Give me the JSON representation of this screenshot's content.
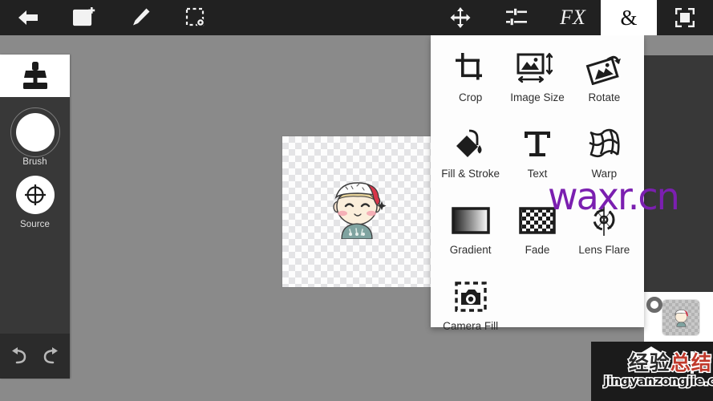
{
  "app": {
    "background_color": "#8a8a8a",
    "toolbar_color": "#212121",
    "panel_color": "#383838",
    "accent_active": "#ffffff"
  },
  "toolbar": {
    "items": [
      {
        "id": "back",
        "icon": "back-arrow-icon",
        "label": "Back",
        "active": false
      },
      {
        "id": "add-image",
        "icon": "add-image-icon",
        "label": "Add Image",
        "active": false
      },
      {
        "id": "brush",
        "icon": "pencil-icon",
        "label": "Brush",
        "active": false
      },
      {
        "id": "selection",
        "icon": "selection-settings-icon",
        "label": "Selection",
        "active": false
      },
      {
        "id": "transform",
        "icon": "move-arrows-icon",
        "label": "Transform",
        "active": false
      },
      {
        "id": "adjustments",
        "icon": "sliders-icon",
        "label": "Adjustments",
        "active": false
      },
      {
        "id": "effects",
        "icon": "fx-icon",
        "label": "FX",
        "active": false
      },
      {
        "id": "tools",
        "icon": "ampersand-icon",
        "label": "&",
        "active": true
      },
      {
        "id": "fullscreen",
        "icon": "fullscreen-icon",
        "label": "Fullscreen",
        "active": false
      }
    ]
  },
  "left_panel": {
    "active_tool_icon": "clone-stamp-icon",
    "controls": [
      {
        "id": "brush",
        "label": "Brush",
        "icon": "brush-dial-icon"
      },
      {
        "id": "source",
        "label": "Source",
        "icon": "source-target-icon"
      }
    ],
    "history": [
      {
        "id": "undo",
        "icon": "undo-arrow-icon"
      },
      {
        "id": "redo",
        "icon": "redo-arrow-icon"
      }
    ]
  },
  "menu": {
    "open": true,
    "opened_from": "&",
    "items": [
      {
        "label": "Crop",
        "icon": "crop-icon"
      },
      {
        "label": "Image Size",
        "icon": "image-size-icon"
      },
      {
        "label": "Rotate",
        "icon": "rotate-icon"
      },
      {
        "label": "Fill & Stroke",
        "icon": "fill-stroke-icon"
      },
      {
        "label": "Text",
        "icon": "text-t-icon"
      },
      {
        "label": "Warp",
        "icon": "warp-grid-icon"
      },
      {
        "label": "Gradient",
        "icon": "gradient-icon"
      },
      {
        "label": "Fade",
        "icon": "fade-checker-icon"
      },
      {
        "label": "Lens Flare",
        "icon": "lens-flare-icon"
      },
      {
        "label": "Camera Fill",
        "icon": "camera-fill-icon"
      }
    ]
  },
  "canvas": {
    "transparent_background": true,
    "content_description": "cartoon-boy-sticker"
  },
  "layers": {
    "add_button_icon": "plus-icon",
    "visibility_toggle_icon": "visibility-dot-icon",
    "layer_thumbnail": "cartoon-boy-sticker-thumbnail"
  },
  "watermarks": {
    "purple_text": "waxr.cn",
    "purple_color": "#7b1fb0",
    "cn_part1": "经验",
    "cn_part2": "总结",
    "cn_part1_color": "#2a2a2a",
    "cn_part2_color": "#c0392b",
    "url": "jingyanzongjie.com"
  }
}
